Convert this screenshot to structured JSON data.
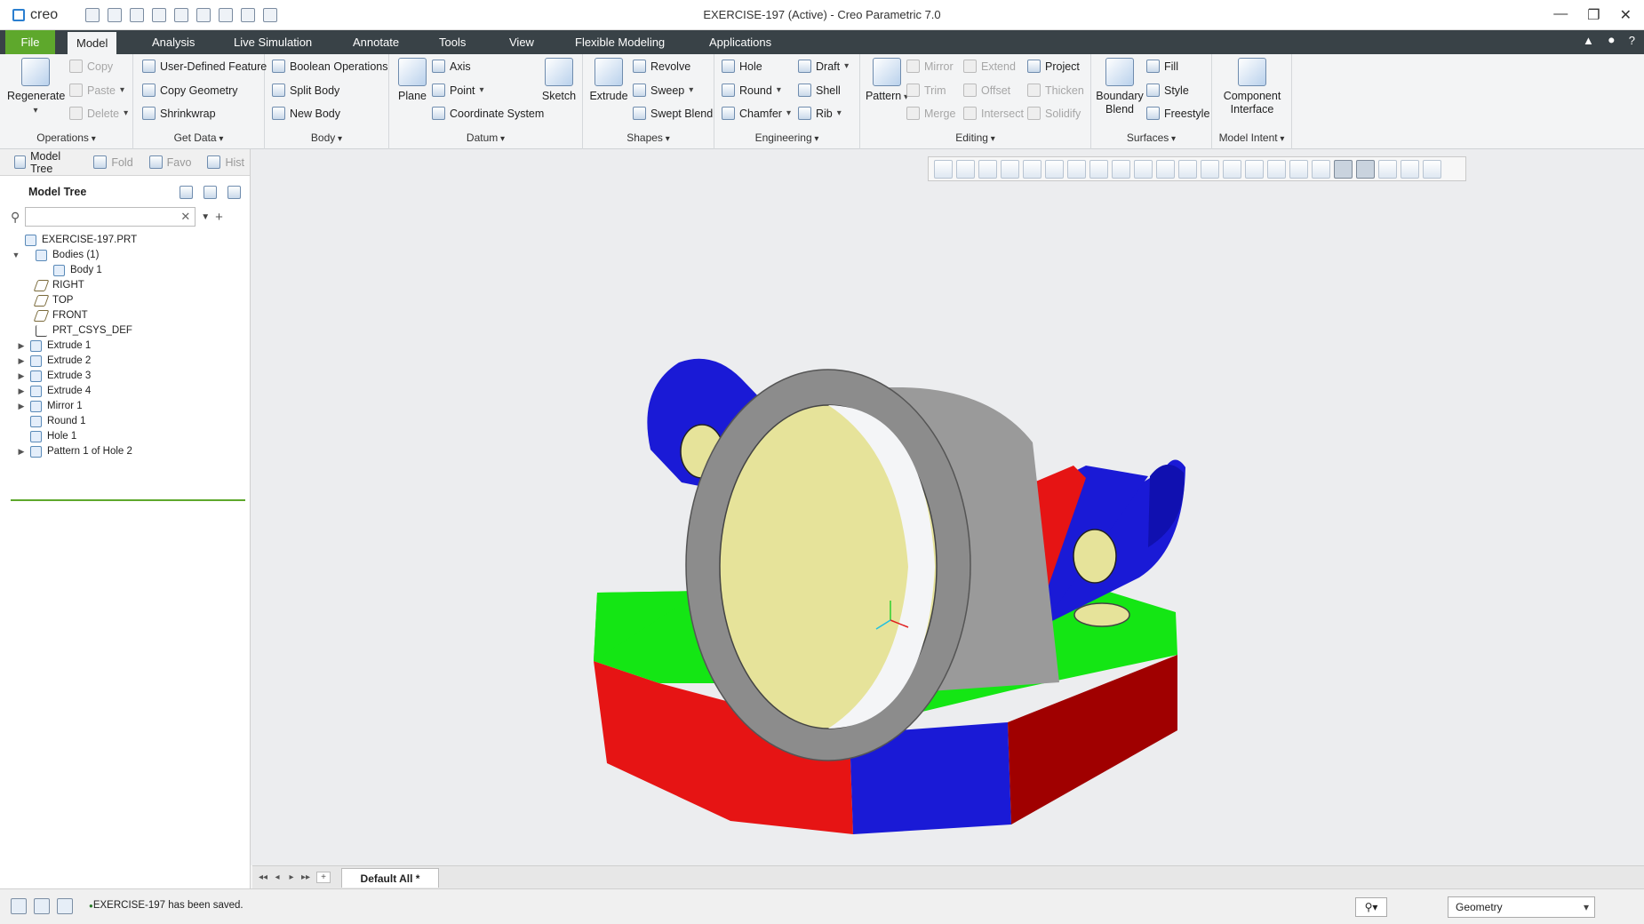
{
  "app": {
    "logo": "creo",
    "window_title": "EXERCISE-197 (Active) - Creo Parametric 7.0",
    "window_controls": [
      "—",
      "❐",
      "✕"
    ]
  },
  "tabs": {
    "file": "File",
    "items": [
      "Model",
      "Analysis",
      "Live Simulation",
      "Annotate",
      "Tools",
      "View",
      "Flexible Modeling",
      "Applications"
    ],
    "right_icons": [
      "▲",
      "⚫",
      "?"
    ]
  },
  "ribbon": {
    "operations": {
      "label": "Operations",
      "regenerate": "Regenerate",
      "copy": "Copy",
      "paste": "Paste",
      "delete": "Delete"
    },
    "get_data": {
      "label": "Get Data",
      "udf": "User-Defined Feature",
      "copy_geometry": "Copy Geometry",
      "shrinkwrap": "Shrinkwrap"
    },
    "body": {
      "label": "Body",
      "boolean": "Boolean Operations",
      "split": "Split Body",
      "new": "New Body"
    },
    "datum": {
      "label": "Datum",
      "plane": "Plane",
      "axis": "Axis",
      "point": "Point",
      "csys": "Coordinate System",
      "sketch": "Sketch"
    },
    "shapes": {
      "label": "Shapes",
      "extrude": "Extrude",
      "revolve": "Revolve",
      "sweep": "Sweep",
      "swept_blend": "Swept Blend"
    },
    "engineering": {
      "label": "Engineering",
      "hole": "Hole",
      "round": "Round",
      "chamfer": "Chamfer",
      "draft": "Draft",
      "shell": "Shell",
      "rib": "Rib"
    },
    "editing": {
      "label": "Editing",
      "pattern": "Pattern",
      "mirror": "Mirror",
      "trim": "Trim",
      "merge": "Merge",
      "extend": "Extend",
      "offset": "Offset",
      "intersect": "Intersect",
      "project": "Project",
      "thicken": "Thicken",
      "solidify": "Solidify"
    },
    "surfaces": {
      "label": "Surfaces",
      "boundary_blend_1": "Boundary",
      "boundary_blend_2": "Blend",
      "fill": "Fill",
      "style": "Style",
      "freestyle": "Freestyle"
    },
    "model_intent": {
      "label": "Model Intent",
      "component_1": "Component",
      "component_2": "Interface"
    }
  },
  "panel": {
    "tabs": [
      "Model Tree",
      "Fold",
      "Favo",
      "Hist"
    ],
    "title": "Model Tree",
    "search_clear": "✕",
    "tree": [
      {
        "label": "EXERCISE-197.PRT",
        "toggle": ""
      },
      {
        "label": "Bodies (1)",
        "toggle": "▼"
      },
      {
        "label": "Body 1",
        "toggle": ""
      },
      {
        "label": "RIGHT",
        "toggle": ""
      },
      {
        "label": "TOP",
        "toggle": ""
      },
      {
        "label": "FRONT",
        "toggle": ""
      },
      {
        "label": "PRT_CSYS_DEF",
        "toggle": ""
      },
      {
        "label": "Extrude 1",
        "toggle": "▶"
      },
      {
        "label": "Extrude 2",
        "toggle": "▶"
      },
      {
        "label": "Extrude 3",
        "toggle": "▶"
      },
      {
        "label": "Extrude 4",
        "toggle": "▶"
      },
      {
        "label": "Mirror 1",
        "toggle": "▶"
      },
      {
        "label": "Round 1",
        "toggle": ""
      },
      {
        "label": "Hole 1",
        "toggle": ""
      },
      {
        "label": "Pattern 1 of Hole 2",
        "toggle": "▶"
      }
    ]
  },
  "bottom": {
    "nav": [
      "◂◂",
      "◂",
      "▸",
      "▸▸",
      "+"
    ],
    "tab": "Default All *"
  },
  "status": {
    "message": "EXERCISE-197 has been saved.",
    "binoculars": "⚲▾",
    "filter": "Geometry"
  },
  "colors": {
    "accent_green": "#5ea82c",
    "tab_bar": "#394247",
    "model_gray": "#8c8c8c",
    "model_yellow": "#e6e39a",
    "model_blue": "#1a1ad6",
    "model_red": "#e61414",
    "model_green": "#14e614"
  }
}
